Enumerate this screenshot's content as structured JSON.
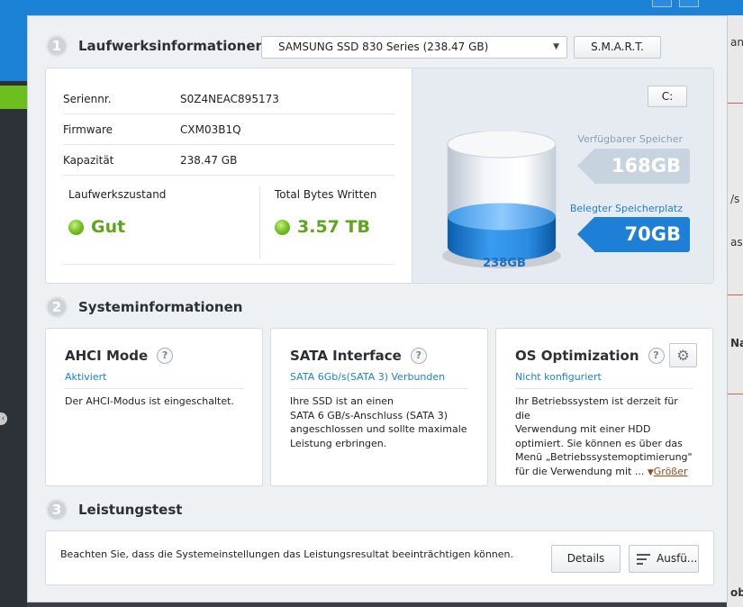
{
  "background": {
    "right_snippets": [
      "an",
      "/s",
      "as",
      "Nac",
      "obr"
    ]
  },
  "drive_info": {
    "section_number": "1",
    "section_title": "Laufwerksinformationen",
    "drive_select_value": "SAMSUNG SSD 830 Series (238.47 GB)",
    "smart_button_label": "S.M.A.R.T.",
    "rows": [
      {
        "label": "Seriennr.",
        "value": "S0Z4NEAC895173"
      },
      {
        "label": "Firmware",
        "value": "CXM03B1Q"
      },
      {
        "label": "Kapazität",
        "value": "238.47 GB"
      }
    ],
    "health_label": "Laufwerkszustand",
    "health_value": "Gut",
    "tbw_label": "Total Bytes Written",
    "tbw_value": "3.57 TB",
    "drive_letter_button": "C:",
    "free_label": "Verfügbarer Speicher",
    "free_value": "168GB",
    "used_label": "Belegter Speicherplatz",
    "used_value": "70GB",
    "total_label": "238GB",
    "used_fraction": 0.294
  },
  "system_info": {
    "section_number": "2",
    "section_title": "Systeminformationen",
    "cards": [
      {
        "title": "AHCI Mode",
        "help": "?",
        "status": "Aktiviert",
        "description": "Der AHCI-Modus ist eingeschaltet."
      },
      {
        "title": "SATA Interface",
        "help": "?",
        "status": "SATA 6Gb/s(SATA 3) Verbunden",
        "description_lines": [
          "Ihre SSD ist an einen",
          "SATA 6 GB/s-Anschluss (SATA 3)",
          "angeschlossen und sollte maximale",
          "Leistung erbringen."
        ]
      },
      {
        "title": "OS Optimization",
        "help": "?",
        "status": "Nicht konfiguriert",
        "description_lines": [
          "Ihr Betriebssystem ist derzeit für die",
          "Verwendung mit einer HDD",
          "optimiert. Sie können es über das",
          "Menü „Betriebssystemoptimierung\"",
          "für die Verwendung mit ..."
        ],
        "more_label": "Größer"
      }
    ]
  },
  "performance": {
    "section_number": "3",
    "section_title": "Leistungstest",
    "note": "Beachten Sie, dass die Systemeinstellungen das Leistungsresultat beeinträchtigen können.",
    "details_button": "Details",
    "run_button": "Ausfü..."
  },
  "colors": {
    "accent_blue": "#1d7fd6",
    "ok_green": "#5fa51c",
    "link_brown": "#9a4a14"
  }
}
